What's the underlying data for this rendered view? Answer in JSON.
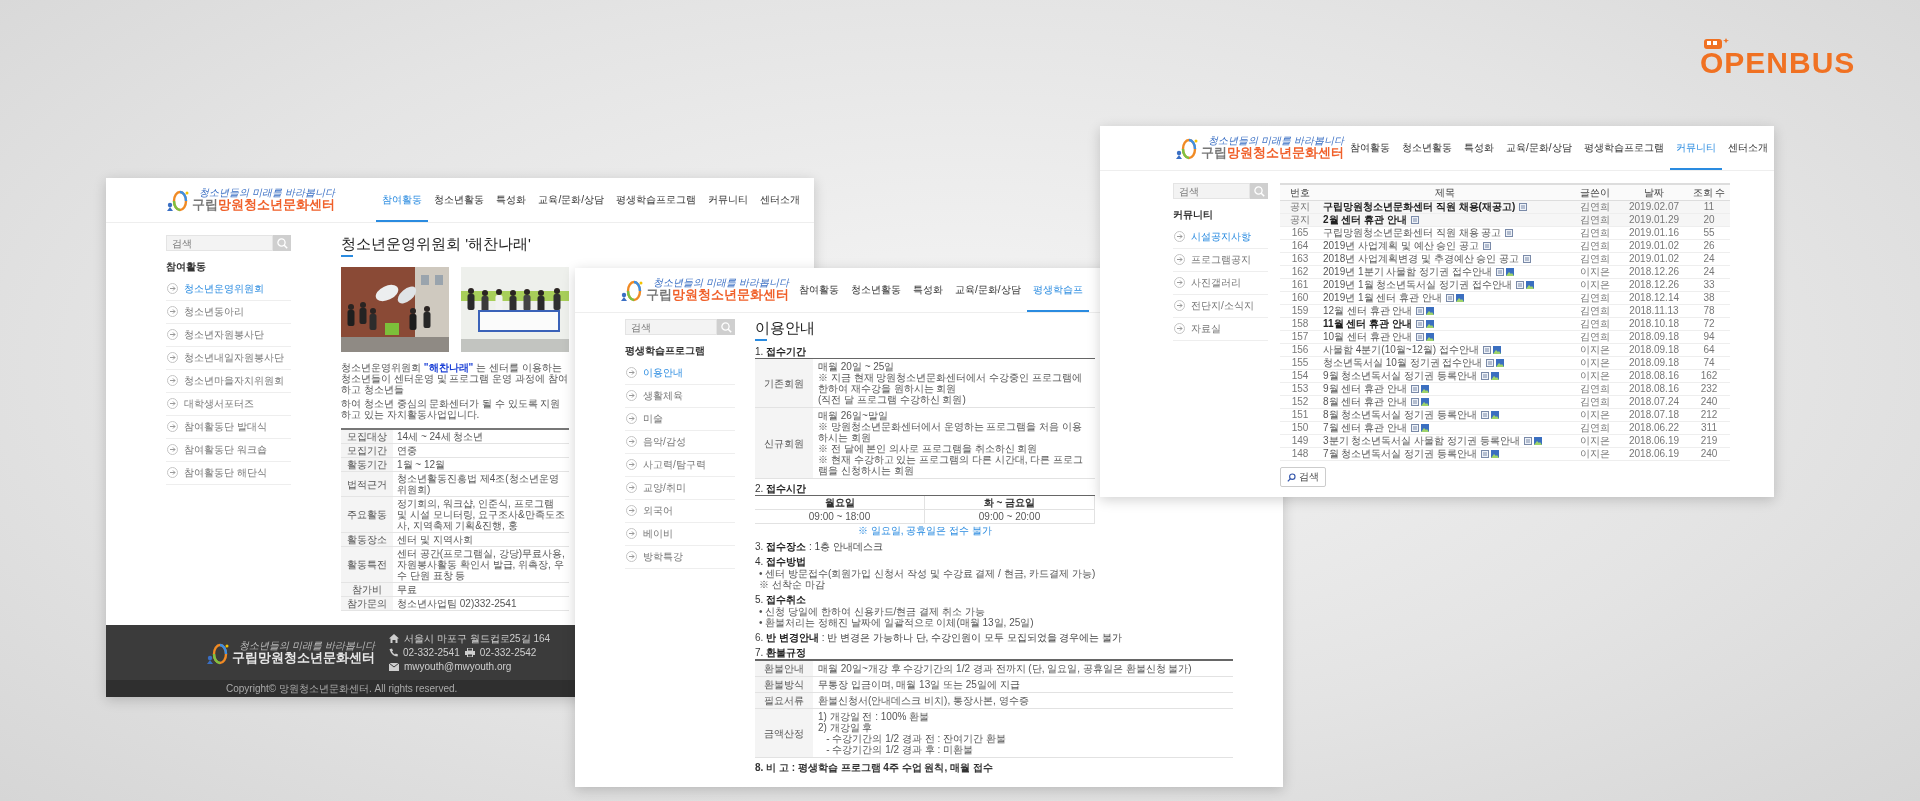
{
  "brand": {
    "logo": "OPENBUS"
  },
  "pages": [
    {
      "kind": "intro",
      "logo": {
        "tagline": "청소년들의 미래를 바라봅니다",
        "prefix": "구립",
        "name": "망원청소년문화센터"
      },
      "nav": [
        {
          "label": "참여활동",
          "selected": true
        },
        {
          "label": "청소년활동",
          "selected": false
        },
        {
          "label": "특성화",
          "selected": false
        },
        {
          "label": "교육/문화/상담",
          "selected": false
        },
        {
          "label": "평생학습프로그램",
          "selected": false
        },
        {
          "label": "커뮤니티",
          "selected": false
        },
        {
          "label": "센터소개",
          "selected": false
        }
      ],
      "sidebar": {
        "search_placeholder": "검색",
        "heading": "참여활동",
        "items": [
          {
            "label": "청소년운영위원회",
            "selected": true
          },
          {
            "label": "청소년동아리",
            "selected": false
          },
          {
            "label": "청소년자원봉사단",
            "selected": false
          },
          {
            "label": "청소년내일자원봉사단",
            "selected": false
          },
          {
            "label": "청소년마을자치위원회",
            "selected": false
          },
          {
            "label": "대학생서포터즈",
            "selected": false
          },
          {
            "label": "참여활동단 발대식",
            "selected": false
          },
          {
            "label": "참여활동단 워크숍",
            "selected": false
          },
          {
            "label": "참여활동단 해단식",
            "selected": false
          }
        ]
      },
      "title": "청소년운영위원회 '해찬나래'",
      "intro": [
        "청소년운영위원회 **\"해찬나래\"** 는 센터를 이용하는 청소년들이 센터운영 및 프로그램 운영 과정에 참여하고 청소년들",
        "하여 청소년 중심의 문화센터가 될 수 있도록 지원하고 있는 자치활동사업입니다."
      ],
      "info_table": [
        {
          "label": "모집대상",
          "value": "14세 ~ 24세 청소년"
        },
        {
          "label": "모집기간",
          "value": "연중"
        },
        {
          "label": "활동기간",
          "value": "1월 ~ 12월"
        },
        {
          "label": "법적근거",
          "value": "청소년활동진흥법 제4조(청소년운영위원회)"
        },
        {
          "label": "주요활동",
          "value": "정기회의, 워크샵, 인준식, 프로그램 및 시설 모니터링, 요구조사&만족도조사, 지역축제 기획&진행, 홍"
        },
        {
          "label": "활동장소",
          "value": "센터 및 지역사회"
        },
        {
          "label": "활동특전",
          "value": "센터 공간(프로그램실, 강당)무료사용, 자원봉사활동 확인서 발급, 위촉장, 우수 단원 표창 등"
        },
        {
          "label": "참가비",
          "value": "무료"
        },
        {
          "label": "참가문의",
          "value": "청소년사업팀 02)332-2541"
        }
      ],
      "footer": {
        "logo": {
          "tagline": "청소년들의 미래를 바라봅니다",
          "prefix": "구립",
          "name": "망원청소년문화센터"
        },
        "address": "서울시 마포구 월드컵로25길 164",
        "phone": "02-332-2541",
        "fax": "02-332-2542",
        "email": "mwyouth@mwyouth.org",
        "copyright": "Copyright© 망원청소년문화센터. All rights reserved."
      }
    },
    {
      "kind": "guide",
      "logo": {
        "tagline": "청소년들의 미래를 바라봅니다",
        "prefix": "구립",
        "name": "망원청소년문화센터"
      },
      "nav": [
        {
          "label": "참여활동",
          "selected": false
        },
        {
          "label": "청소년활동",
          "selected": false
        },
        {
          "label": "특성화",
          "selected": false
        },
        {
          "label": "교육/문화/상담",
          "selected": false
        },
        {
          "label": "평생학습프",
          "selected": true
        }
      ],
      "sidebar": {
        "search_placeholder": "검색",
        "heading": "평생학습프로그램",
        "items": [
          {
            "label": "이용안내",
            "selected": true
          },
          {
            "label": "생활체육",
            "selected": false
          },
          {
            "label": "미술",
            "selected": false
          },
          {
            "label": "음악/감성",
            "selected": false
          },
          {
            "label": "사고력/탐구력",
            "selected": false
          },
          {
            "label": "교양/취미",
            "selected": false
          },
          {
            "label": "외국어",
            "selected": false
          },
          {
            "label": "베이비",
            "selected": false
          },
          {
            "label": "방학특강",
            "selected": false
          }
        ]
      },
      "title": "이용안내",
      "sections": [
        {
          "kind": "table",
          "number": "1.",
          "title": "접수기간",
          "rows": [
            {
              "label": "기존회원",
              "lines": [
                "매월 20일 ~ 25일",
                "※ 지금 현재 망원청소년문화센터에서 수강중인 프로그램에 한하여 재수강을 원하시는 회원",
                "(직전 달 프로그램 수강하신 회원)"
              ]
            },
            {
              "label": "신규회원",
              "lines": [
                "매월 26일~말일",
                "※ 망원청소년문화센터에서 운영하는 프로그램을 처음 이용하시는 회원",
                "※ 전 달에 본인 의사로 프로그램을 취소하신 회원",
                "※ 현재 수강하고 있는 프로그램의 다른 시간대, 다른 프로그램을 신청하시는 회원"
              ]
            }
          ]
        },
        {
          "kind": "hours",
          "number": "2.",
          "title": "접수시간",
          "columns": [
            "월요일",
            "화 ~ 금요일"
          ],
          "values": [
            "09:00 ~ 18:00",
            "09:00 ~ 20:00"
          ],
          "note": "※ 일요일, 공휴일은 접수 불가"
        },
        {
          "kind": "line",
          "text": "3. **접수장소** : 1층 안내데스크"
        },
        {
          "kind": "list",
          "number": "4.",
          "title": "접수방법",
          "lines": [
            "• 센터 방문접수(회원가입 신청서 작성 및 수강료 결제 / 현금, 카드결제 가능)",
            "※ 선착순 마감"
          ]
        },
        {
          "kind": "list",
          "number": "5.",
          "title": "접수취소",
          "lines": [
            "• 신청 당일에 한하여 신용카드/현금 결제 취소 가능",
            "• 환불처리는 정해진 날짜에 일괄적으로 이체(매월 13일, 25일)"
          ]
        },
        {
          "kind": "line",
          "text": "6. **반 변경안내** : 반 변경은 가능하나 단, 수강인원이 모두 모집되었을 경우에는 불가"
        },
        {
          "kind": "table",
          "number": "7.",
          "title": "환불규정",
          "rows": [
            {
              "label": "환불안내",
              "lines": [
                "매월 20일~개강 후 수강기간의 1/2 경과 전까지 (단, 일요일, 공휴일은 환불신청 불가)"
              ]
            },
            {
              "label": "환불방식",
              "lines": [
                "무통장 입금이며, 매월 13일 또는 25일에 지급"
              ]
            },
            {
              "label": "필요서류",
              "lines": [
                "환불신청서(안내데스크 비치), 통장사본, 영수증"
              ]
            },
            {
              "label": "금액산정",
              "lines": [
                "1) 개강일 전 : 100% 환불",
                "2) 개강일 후",
                "   - 수강기간의 1/2 경과 전 : 잔여기간 환불",
                "   - 수강기간의 1/2 경과 후 : 미환불"
              ]
            }
          ]
        },
        {
          "kind": "remark",
          "text": "8. 비 고 : 평생학습 프로그램 4주 수업 원칙, 매월 접수"
        }
      ]
    },
    {
      "kind": "board",
      "logo": {
        "tagline": "청소년들의 미래를 바라봅니다",
        "prefix": "구립",
        "name": "망원청소년문화센터"
      },
      "nav": [
        {
          "label": "참여활동",
          "selected": false
        },
        {
          "label": "청소년활동",
          "selected": false
        },
        {
          "label": "특성화",
          "selected": false
        },
        {
          "label": "교육/문화/상담",
          "selected": false
        },
        {
          "label": "평생학습프로그램",
          "selected": false
        },
        {
          "label": "커뮤니티",
          "selected": true
        },
        {
          "label": "센터소개",
          "selected": false
        }
      ],
      "sidebar": {
        "search_placeholder": "검색",
        "heading": "커뮤니티",
        "items": [
          {
            "label": "시설공지사항",
            "selected": true
          },
          {
            "label": "프로그램공지",
            "selected": false
          },
          {
            "label": "사진갤러리",
            "selected": false
          },
          {
            "label": "전단지/소식지",
            "selected": false
          },
          {
            "label": "자료실",
            "selected": false
          }
        ]
      },
      "columns": [
        "번호",
        "제목",
        "글쓴이",
        "날짜",
        "조회 수"
      ],
      "rows": [
        {
          "kind": "notice",
          "number": "공지",
          "title": "구립망원청소년문화센터 직원 채용(재공고)",
          "author": "김연희",
          "date": "2019.02.07",
          "views": "11",
          "bold": true,
          "photo": false
        },
        {
          "kind": "notice",
          "number": "공지",
          "title": "2월 센터 휴관 안내",
          "author": "김연희",
          "date": "2019.01.29",
          "views": "20",
          "bold": true,
          "photo": false
        },
        {
          "kind": "post",
          "number": "165",
          "title": "구립망원청소년문화센터 직원 채용 공고",
          "author": "김연희",
          "date": "2019.01.16",
          "views": "55",
          "bold": false,
          "photo": false
        },
        {
          "kind": "post",
          "number": "164",
          "title": "2019년 사업계획 및 예산 승인 공고",
          "author": "김연희",
          "date": "2019.01.02",
          "views": "26",
          "bold": false,
          "photo": false
        },
        {
          "kind": "post",
          "number": "163",
          "title": "2018년 사업계획변경 및 추경예산 승인 공고",
          "author": "김연희",
          "date": "2019.01.02",
          "views": "24",
          "bold": false,
          "photo": false
        },
        {
          "kind": "post",
          "number": "162",
          "title": "2019년 1분기 사물함 정기권 접수안내",
          "author": "이지은",
          "date": "2018.12.26",
          "views": "24",
          "bold": false,
          "photo": true
        },
        {
          "kind": "post",
          "number": "161",
          "title": "2019년 1월 청소년독서실 정기권 접수안내",
          "author": "이지은",
          "date": "2018.12.26",
          "views": "33",
          "bold": false,
          "photo": true
        },
        {
          "kind": "post",
          "number": "160",
          "title": "2019년 1월 센터 휴관 안내",
          "author": "김연희",
          "date": "2018.12.14",
          "views": "38",
          "bold": false,
          "photo": true
        },
        {
          "kind": "post",
          "number": "159",
          "title": "12월 센터 휴관 안내",
          "author": "김연희",
          "date": "2018.11.13",
          "views": "78",
          "bold": false,
          "photo": true
        },
        {
          "kind": "post",
          "number": "158",
          "title": "11월 센터 휴관 안내",
          "author": "김연희",
          "date": "2018.10.18",
          "views": "72",
          "bold": true,
          "photo": true
        },
        {
          "kind": "post",
          "number": "157",
          "title": "10월 센터 휴관 안내",
          "author": "김연희",
          "date": "2018.09.18",
          "views": "94",
          "bold": false,
          "photo": true
        },
        {
          "kind": "post",
          "number": "156",
          "title": "사물함 4분기(10월~12월) 접수안내",
          "author": "이지은",
          "date": "2018.09.18",
          "views": "64",
          "bold": false,
          "photo": true
        },
        {
          "kind": "post",
          "number": "155",
          "title": "청소년독서실 10월 정기권 접수안내",
          "author": "이지은",
          "date": "2018.09.18",
          "views": "74",
          "bold": false,
          "photo": true
        },
        {
          "kind": "post",
          "number": "154",
          "title": "9월 청소년독서실 정기권 등록안내",
          "author": "이지은",
          "date": "2018.08.16",
          "views": "162",
          "bold": false,
          "photo": true
        },
        {
          "kind": "post",
          "number": "153",
          "title": "9월 센터 휴관 안내",
          "author": "김연희",
          "date": "2018.08.16",
          "views": "232",
          "bold": false,
          "photo": true
        },
        {
          "kind": "post",
          "number": "152",
          "title": "8월 센터 휴관 안내",
          "author": "김연희",
          "date": "2018.07.24",
          "views": "240",
          "bold": false,
          "photo": true
        },
        {
          "kind": "post",
          "number": "151",
          "title": "8월 청소년독서실 정기권 등록안내",
          "author": "이지은",
          "date": "2018.07.18",
          "views": "212",
          "bold": false,
          "photo": true
        },
        {
          "kind": "post",
          "number": "150",
          "title": "7월 센터 휴관 안내",
          "author": "김연희",
          "date": "2018.06.22",
          "views": "311",
          "bold": false,
          "photo": true
        },
        {
          "kind": "post",
          "number": "149",
          "title": "3분기 청소년독서실 사물함 정기권 등록안내",
          "author": "이지은",
          "date": "2018.06.19",
          "views": "219",
          "bold": false,
          "photo": true
        },
        {
          "kind": "post",
          "number": "148",
          "title": "7월 청소년독서실 정기권 등록안내",
          "author": "이지은",
          "date": "2018.06.19",
          "views": "240",
          "bold": false,
          "photo": true
        }
      ],
      "search_button": "검색"
    }
  ]
}
